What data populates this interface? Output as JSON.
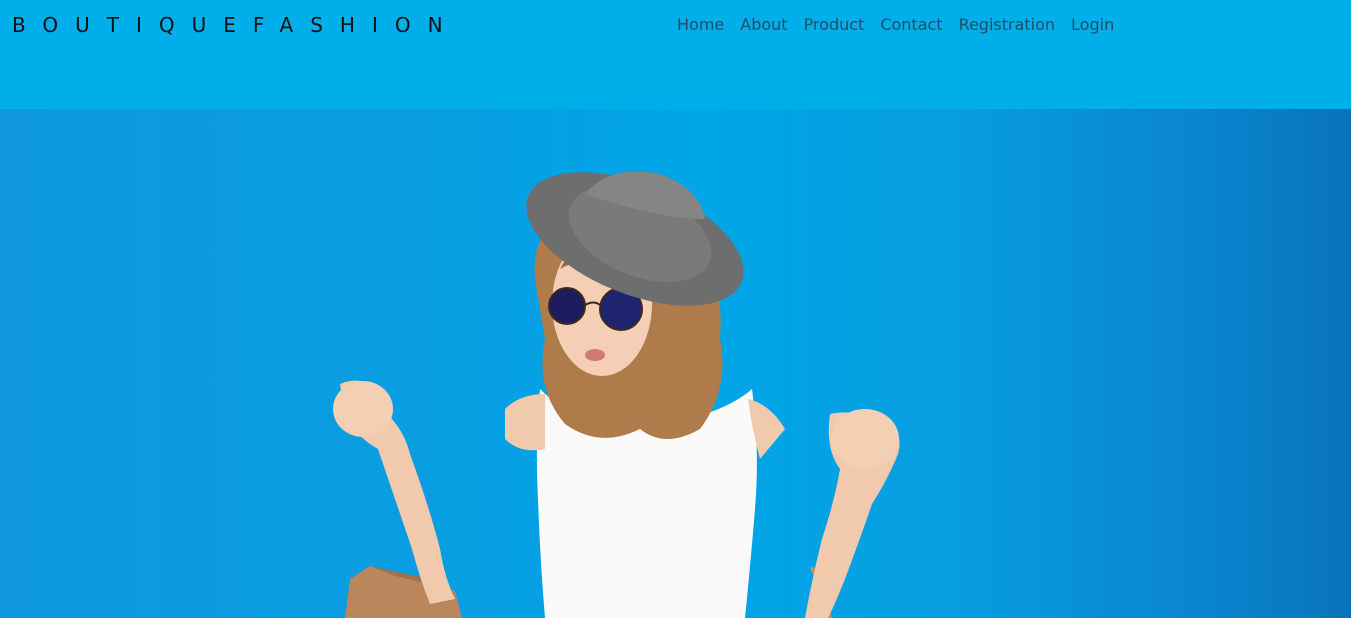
{
  "header": {
    "brand": "BOUTIQUEFASHION",
    "bg_color": "#00aeea"
  },
  "nav": {
    "items": [
      {
        "label": "Home"
      },
      {
        "label": "About"
      },
      {
        "label": "Product"
      },
      {
        "label": "Contact"
      },
      {
        "label": "Registration"
      },
      {
        "label": "Login"
      }
    ]
  },
  "hero": {
    "background_color": "#089fe3"
  }
}
